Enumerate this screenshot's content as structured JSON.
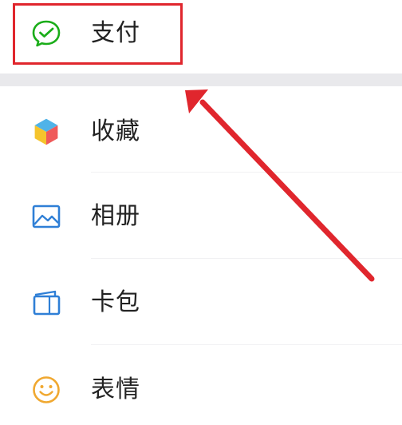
{
  "menu": {
    "items": [
      {
        "label": "支付",
        "icon": "wechat-pay-icon",
        "color": "#1aad19"
      },
      {
        "label": "收藏",
        "icon": "favorites-cube-icon",
        "color": "#e8b10e"
      },
      {
        "label": "相册",
        "icon": "album-picture-icon",
        "color": "#2f7fd6"
      },
      {
        "label": "卡包",
        "icon": "card-wallet-icon",
        "color": "#2f7fd6"
      },
      {
        "label": "表情",
        "icon": "sticker-smile-icon",
        "color": "#f0a830"
      }
    ]
  },
  "annotation": {
    "highlight_color": "#e0262d",
    "highlighted_item": "支付"
  }
}
